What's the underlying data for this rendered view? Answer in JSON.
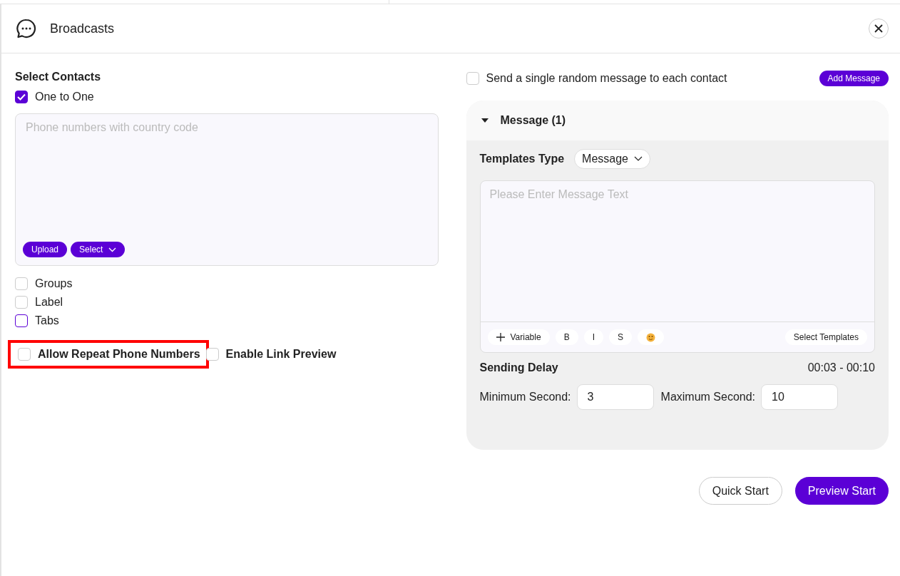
{
  "window": {
    "title": "Broadcasts"
  },
  "contacts": {
    "title": "Select Contacts",
    "primary_option": {
      "label": "One to One",
      "checked": true
    },
    "phone_field": {
      "placeholder": "Phone numbers with country code"
    },
    "field_buttons": [
      {
        "label": "Upload",
        "kind": "button"
      },
      {
        "label": "Select",
        "kind": "dropdown"
      }
    ],
    "options": [
      {
        "label": "Groups",
        "checked": false,
        "focused": false
      },
      {
        "label": "Label",
        "checked": false,
        "focused": false
      },
      {
        "label": "Tabs",
        "checked": false,
        "focused": true
      }
    ]
  },
  "extra_options": [
    {
      "label": "Allow Repeat Phone Numbers",
      "checked": false,
      "highlighted": true
    },
    {
      "label": "Enable Link Preview",
      "checked": false,
      "highlighted": false
    }
  ],
  "random_message": {
    "label": "Send a single random message to each contact",
    "checked": false
  },
  "add_message_button": "Add Message",
  "message_panel": {
    "title": "Message (1)",
    "expanded": true,
    "templates_type_label": "Templates Type",
    "templates_type_value": "Message",
    "message_field": {
      "placeholder": "Please Enter Message Text"
    },
    "toolbar": [
      {
        "kind": "variable",
        "label": "Variable"
      },
      {
        "kind": "format",
        "label": "B"
      },
      {
        "kind": "format",
        "label": "I"
      },
      {
        "kind": "format",
        "label": "S"
      },
      {
        "kind": "emoji"
      }
    ],
    "select_templates": "Select Templates",
    "delay_label": "Sending Delay",
    "delay_range": "00:03 - 00:10",
    "min_label": "Minimum Second:",
    "min_value": "3",
    "max_label": "Maximum Second:",
    "max_value": "10"
  },
  "actions": [
    {
      "label": "Quick Start",
      "kind": "secondary"
    },
    {
      "label": "Preview Start",
      "kind": "primary"
    }
  ]
}
